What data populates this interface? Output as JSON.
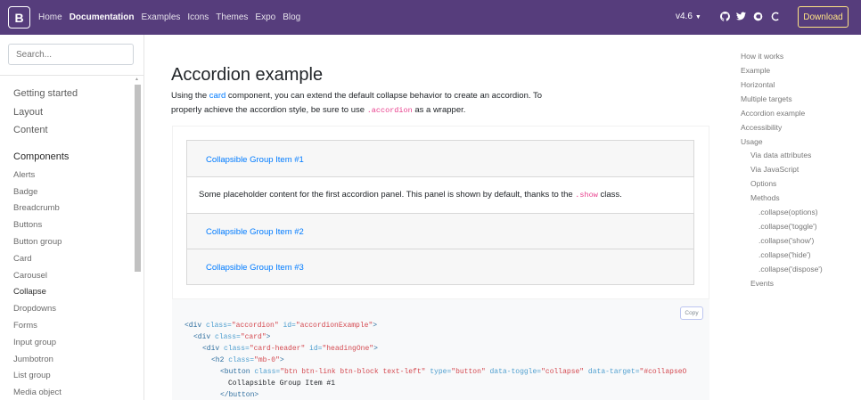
{
  "navbar": {
    "brand": "B",
    "links": [
      {
        "label": "Home",
        "active": false
      },
      {
        "label": "Documentation",
        "active": true
      },
      {
        "label": "Examples",
        "active": false
      },
      {
        "label": "Icons",
        "active": false
      },
      {
        "label": "Themes",
        "active": false
      },
      {
        "label": "Expo",
        "active": false
      },
      {
        "label": "Blog",
        "active": false
      }
    ],
    "version": "v4.6",
    "download": "Download",
    "icons": [
      "github-icon",
      "twitter-icon",
      "opencollective-icon",
      "slack-icon"
    ],
    "bg_color": "#563d7c",
    "download_color": "#ffe484"
  },
  "sidebar": {
    "search_placeholder": "Search...",
    "sections": [
      "Getting started",
      "Layout",
      "Content",
      "Components"
    ],
    "components": [
      "Alerts",
      "Badge",
      "Breadcrumb",
      "Buttons",
      "Button group",
      "Card",
      "Carousel",
      "Collapse",
      "Dropdowns",
      "Forms",
      "Input group",
      "Jumbotron",
      "List group",
      "Media object"
    ],
    "current": "Collapse"
  },
  "main": {
    "title": "Accordion example",
    "lead_1": "Using the ",
    "lead_link": "card",
    "lead_2": " component, you can extend the default collapse behavior to create an accordion. To",
    "lead_3": "properly achieve the accordion style, be sure to use ",
    "lead_code": ".accordion",
    "lead_4": " as a wrapper.",
    "accordion": {
      "item1": "Collapsible Group Item #1",
      "body_1": "Some placeholder content for the first accordion panel. This panel is shown by default, thanks to the ",
      "body_code": ".show",
      "body_2": " class.",
      "item2": "Collapsible Group Item #2",
      "item3": "Collapsible Group Item #3"
    },
    "copy": "Copy",
    "code": {
      "l1": [
        "<div ",
        "class=",
        "\"accordion\"",
        " id=",
        "\"accordionExample\"",
        ">"
      ],
      "l2": [
        "<div ",
        "class=",
        "\"card\"",
        ">"
      ],
      "l3": [
        "<div ",
        "class=",
        "\"card-header\"",
        " id=",
        "\"headingOne\"",
        ">"
      ],
      "l4": [
        "<h2 ",
        "class=",
        "\"mb-0\"",
        ">"
      ],
      "l5": [
        "<button ",
        "class=",
        "\"btn btn-link btn-block text-left\"",
        " type=",
        "\"button\"",
        " data-toggle=",
        "\"collapse\"",
        " data-target=",
        "\"#collapseO"
      ],
      "l6": "Collapsible Group Item #1",
      "l7": "</button>"
    }
  },
  "toc": {
    "items": [
      {
        "label": "How it works",
        "level": 0
      },
      {
        "label": "Example",
        "level": 0
      },
      {
        "label": "Horizontal",
        "level": 0
      },
      {
        "label": "Multiple targets",
        "level": 0
      },
      {
        "label": "Accordion example",
        "level": 0
      },
      {
        "label": "Accessibility",
        "level": 0
      },
      {
        "label": "Usage",
        "level": 0
      },
      {
        "label": "Via data attributes",
        "level": 1
      },
      {
        "label": "Via JavaScript",
        "level": 1
      },
      {
        "label": "Options",
        "level": 1
      },
      {
        "label": "Methods",
        "level": 1
      },
      {
        "label": ".collapse(options)",
        "level": 2
      },
      {
        "label": ".collapse('toggle')",
        "level": 2
      },
      {
        "label": ".collapse('show')",
        "level": 2
      },
      {
        "label": ".collapse('hide')",
        "level": 2
      },
      {
        "label": ".collapse('dispose')",
        "level": 2
      },
      {
        "label": "Events",
        "level": 1
      }
    ]
  }
}
